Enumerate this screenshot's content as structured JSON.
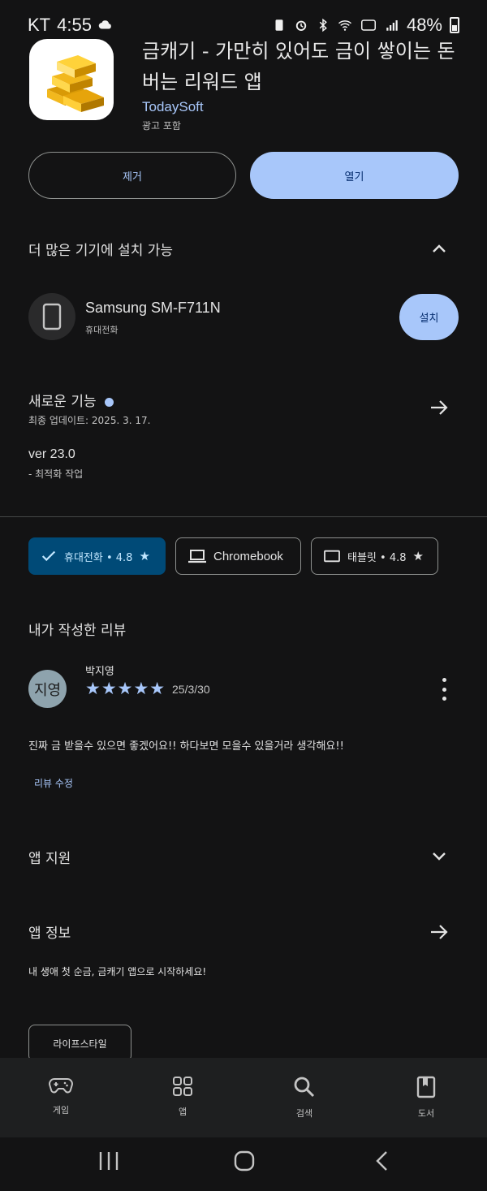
{
  "status_bar": {
    "carrier": "KT",
    "time": "4:55",
    "battery": "48%"
  },
  "app": {
    "title": "금캐기 - 가만히 있어도 금이 쌓이는 돈버는 리워드 앱",
    "developer": "TodaySoft",
    "ads": "광고 포함",
    "remove_label": "제거",
    "open_label": "열기"
  },
  "more_devices": {
    "title": "더 많은 기기에 설치 가능",
    "device_name": "Samsung SM-F711N",
    "device_type": "휴대전화",
    "install_label": "설치"
  },
  "whats_new": {
    "title": "새로운 기능",
    "updated": "최종 업데이트: 2025. 3. 17.",
    "version": "ver 23.0",
    "note": "- 최적화 작업"
  },
  "chips": [
    {
      "label": "휴대전화 • 4.8",
      "icon": "check-icon",
      "star": "★"
    },
    {
      "label": "Chromebook",
      "icon": "laptop-icon"
    },
    {
      "label": "태블릿 • 4.8",
      "icon": "tablet-icon",
      "star": "★"
    }
  ],
  "my_review": {
    "title": "내가 작성한 리뷰",
    "avatar_text": "지영",
    "reviewer": "박지영",
    "rating": 5,
    "stars": "★★★★★",
    "date": "25/3/30",
    "body": "진짜 금 받을수 있으면 좋겠어요!! 하다보면 모을수 있을거라 생각해요!!",
    "edit_label": "리뷰 수정"
  },
  "app_support": {
    "title": "앱 지원"
  },
  "app_info": {
    "title": "앱 정보",
    "tagline": "내 생애 첫 순금, 금캐기 앱으로 시작하세요!",
    "tag": "라이프스타일"
  },
  "bottom_nav": [
    {
      "label": "게임",
      "icon": "gamepad-icon"
    },
    {
      "label": "앱",
      "icon": "apps-grid-icon"
    },
    {
      "label": "검색",
      "icon": "search-icon"
    },
    {
      "label": "도서",
      "icon": "book-icon"
    }
  ],
  "colors": {
    "background": "#131314",
    "accent": "#a8c7fa",
    "selected_chip": "#004a77"
  }
}
